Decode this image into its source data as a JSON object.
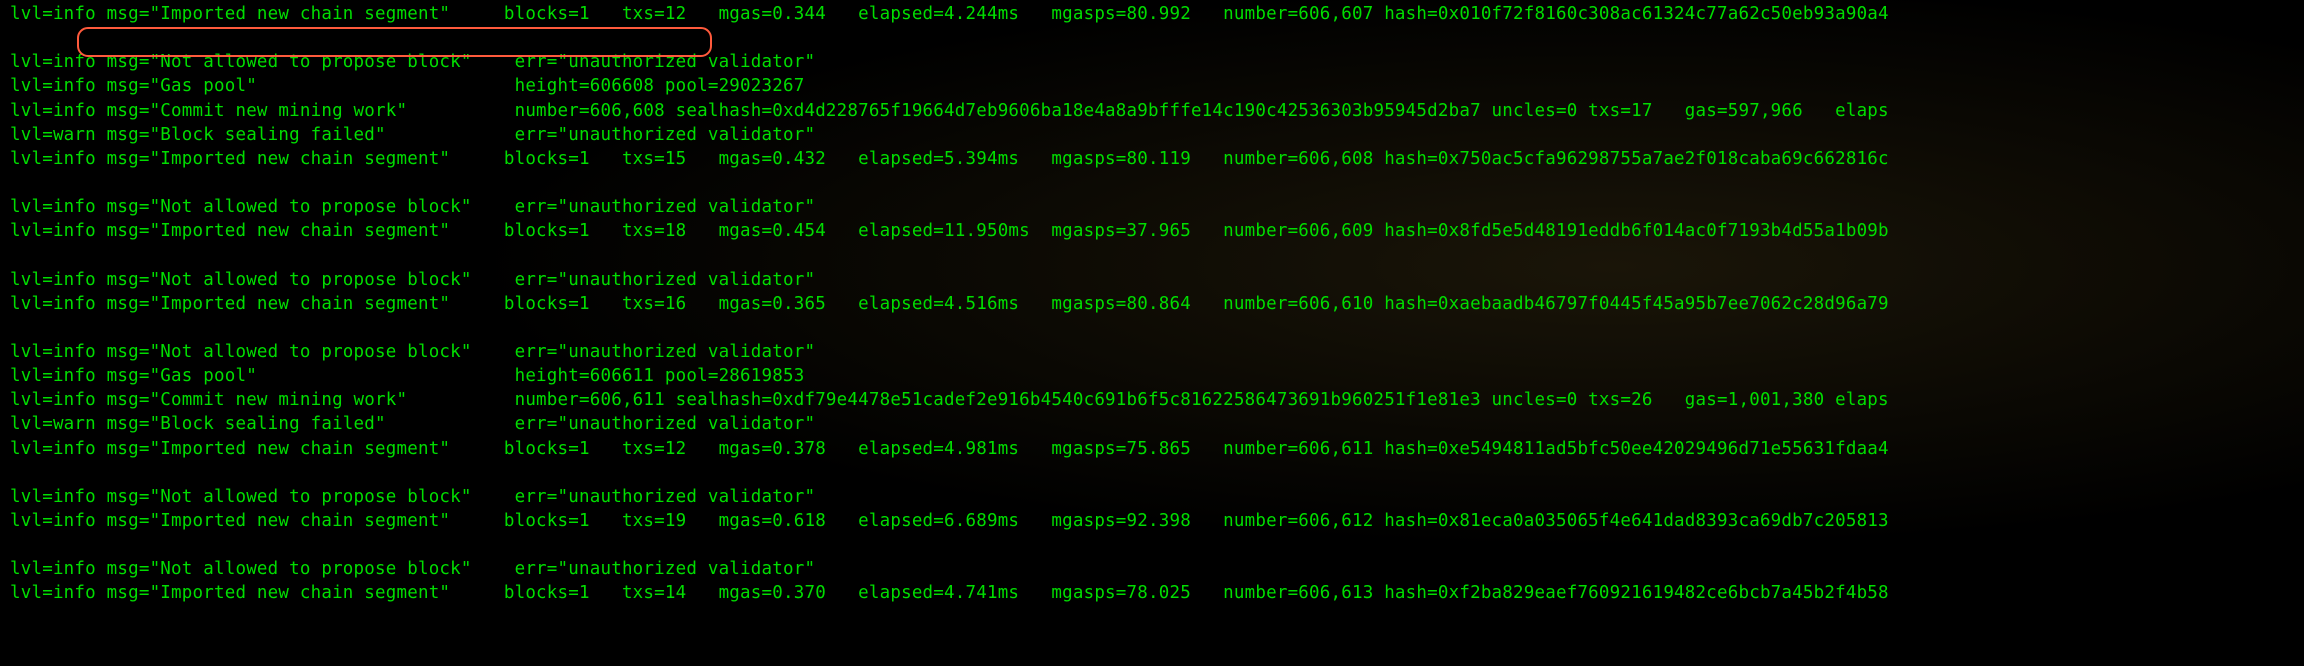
{
  "lines": [
    "lvl=info msg=\"Imported new chain segment\"     blocks=1   txs=12   mgas=0.344   elapsed=4.244ms   mgasps=80.992   number=606,607 hash=0x010f72f8160c308ac61324c77a62c50eb93a90a4",
    "",
    "lvl=info msg=\"Not allowed to propose block\"    err=\"unauthorized validator\"",
    "lvl=info msg=\"Gas pool\"                        height=606608 pool=29023267",
    "lvl=info msg=\"Commit new mining work\"          number=606,608 sealhash=0xd4d228765f19664d7eb9606ba18e4a8a9bfffe14c190c42536303b95945d2ba7 uncles=0 txs=17   gas=597,966   elaps",
    "lvl=warn msg=\"Block sealing failed\"            err=\"unauthorized validator\"",
    "lvl=info msg=\"Imported new chain segment\"     blocks=1   txs=15   mgas=0.432   elapsed=5.394ms   mgasps=80.119   number=606,608 hash=0x750ac5cfa96298755a7ae2f018caba69c662816c",
    "",
    "lvl=info msg=\"Not allowed to propose block\"    err=\"unauthorized validator\"",
    "lvl=info msg=\"Imported new chain segment\"     blocks=1   txs=18   mgas=0.454   elapsed=11.950ms  mgasps=37.965   number=606,609 hash=0x8fd5e5d48191eddb6f014ac0f7193b4d55a1b09b",
    "",
    "lvl=info msg=\"Not allowed to propose block\"    err=\"unauthorized validator\"",
    "lvl=info msg=\"Imported new chain segment\"     blocks=1   txs=16   mgas=0.365   elapsed=4.516ms   mgasps=80.864   number=606,610 hash=0xaebaadb46797f0445f45a95b7ee7062c28d96a79",
    "",
    "lvl=info msg=\"Not allowed to propose block\"    err=\"unauthorized validator\"",
    "lvl=info msg=\"Gas pool\"                        height=606611 pool=28619853",
    "lvl=info msg=\"Commit new mining work\"          number=606,611 sealhash=0xdf79e4478e51cadef2e916b4540c691b6f5c81622586473691b960251f1e81e3 uncles=0 txs=26   gas=1,001,380 elaps",
    "lvl=warn msg=\"Block sealing failed\"            err=\"unauthorized validator\"",
    "lvl=info msg=\"Imported new chain segment\"     blocks=1   txs=12   mgas=0.378   elapsed=4.981ms   mgasps=75.865   number=606,611 hash=0xe5494811ad5bfc50ee42029496d71e55631fdaa4",
    "",
    "lvl=info msg=\"Not allowed to propose block\"    err=\"unauthorized validator\"",
    "lvl=info msg=\"Imported new chain segment\"     blocks=1   txs=19   mgas=0.618   elapsed=6.689ms   mgasps=92.398   number=606,612 hash=0x81eca0a035065f4e641dad8393ca69db7c205813",
    "",
    "lvl=info msg=\"Not allowed to propose block\"    err=\"unauthorized validator\"",
    "lvl=info msg=\"Imported new chain segment\"     blocks=1   txs=14   mgas=0.370   elapsed=4.741ms   mgasps=78.025   number=606,613 hash=0xf2ba829eaef760921619482ce6bcb7a45b2f4b58",
    ""
  ],
  "annotation": {
    "highlighted_text": "msg=\"Not allowed to propose block\"    err=\"unauthorized validator\""
  }
}
